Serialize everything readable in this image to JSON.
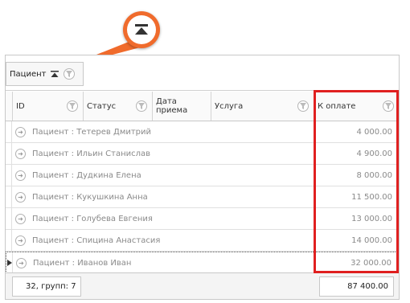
{
  "group_panel": {
    "chip_label": "Пациент"
  },
  "columns": [
    {
      "label": "ID"
    },
    {
      "label": "Статус"
    },
    {
      "label": "Дата\nприема"
    },
    {
      "label": "Услуга"
    },
    {
      "label": "К оплате"
    }
  ],
  "rows": [
    {
      "group": "Пациент : Тетерев Дмитрий",
      "amount": "4 000.00"
    },
    {
      "group": "Пациент : Ильин Станислав",
      "amount": "4 900.00"
    },
    {
      "group": "Пациент : Дудкина Елена",
      "amount": "8 000.00"
    },
    {
      "group": "Пациент : Кукушкина Анна",
      "amount": "11 500.00"
    },
    {
      "group": "Пациент : Голубева Евгения",
      "amount": "13 000.00"
    },
    {
      "group": "Пациент : Спицина Анастасия",
      "amount": "14 000.00"
    },
    {
      "group": "Пациент : Иванов Иван",
      "amount": "32 000.00"
    }
  ],
  "footer": {
    "count_summary": "32, групп: 7",
    "total": "87 400.00"
  },
  "colors": {
    "callout": "#f06b2c",
    "highlight": "#e02020"
  }
}
